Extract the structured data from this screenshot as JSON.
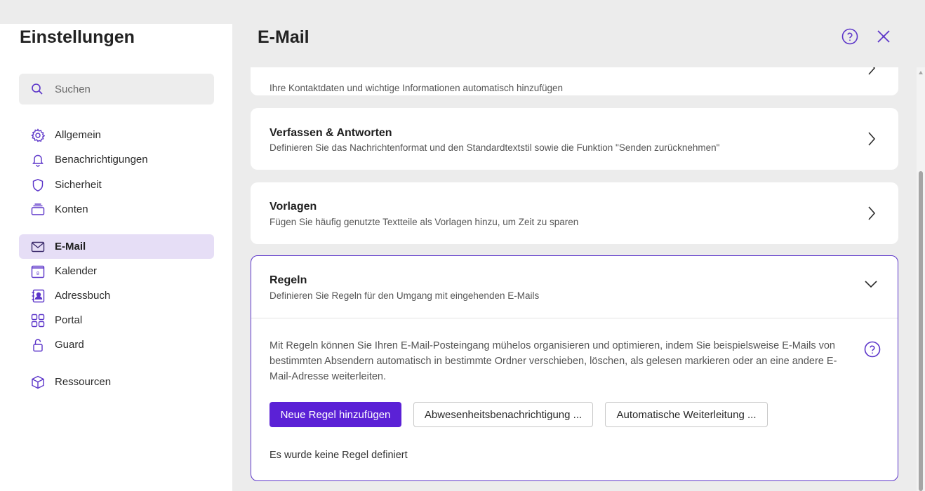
{
  "sidebar": {
    "title": "Einstellungen",
    "search_placeholder": "Suchen",
    "items": [
      {
        "label": "Allgemein",
        "icon": "gear-icon"
      },
      {
        "label": "Benachrichtigungen",
        "icon": "bell-icon"
      },
      {
        "label": "Sicherheit",
        "icon": "shield-icon"
      },
      {
        "label": "Konten",
        "icon": "stack-icon"
      },
      {
        "label": "E-Mail",
        "icon": "mail-icon",
        "active": true
      },
      {
        "label": "Kalender",
        "icon": "calendar-icon",
        "calendar_day": "8"
      },
      {
        "label": "Adressbuch",
        "icon": "contact-book-icon"
      },
      {
        "label": "Portal",
        "icon": "grid-icon"
      },
      {
        "label": "Guard",
        "icon": "lock-icon"
      },
      {
        "label": "Ressourcen",
        "icon": "cube-icon"
      }
    ]
  },
  "header": {
    "title": "E-Mail",
    "help_icon": "help-circle-icon",
    "close_icon": "close-icon"
  },
  "cards": {
    "contact": {
      "desc": "Ihre Kontaktdaten und wichtige Informationen automatisch hinzufügen"
    },
    "compose": {
      "title": "Verfassen & Antworten",
      "desc": "Definieren Sie das Nachrichtenformat und den Standardtextstil sowie die Funktion \"Senden zurücknehmen\""
    },
    "templates": {
      "title": "Vorlagen",
      "desc": "Fügen Sie häufig genutzte Textteile als Vorlagen hinzu, um Zeit zu sparen"
    },
    "rules": {
      "title": "Regeln",
      "desc": "Definieren Sie Regeln für den Umgang mit eingehenden E-Mails",
      "body": "Mit Regeln können Sie Ihren E-Mail-Posteingang mühelos organisieren und optimieren, indem Sie beispielsweise E-Mails von bestimmten Absendern automatisch in bestimmte Ordner verschieben, löschen, als gelesen markieren oder an eine andere E-Mail-Adresse weiterleiten.",
      "buttons": {
        "add": "Neue Regel hinzufügen",
        "absence": "Abwesenheitsbenachrichtigung ...",
        "forward": "Automatische Weiterleitung ..."
      },
      "empty": "Es wurde keine Regel definiert"
    }
  },
  "colors": {
    "accent": "#5b21d6",
    "icon": "#5b34c9",
    "active_bg": "#e6def6"
  }
}
